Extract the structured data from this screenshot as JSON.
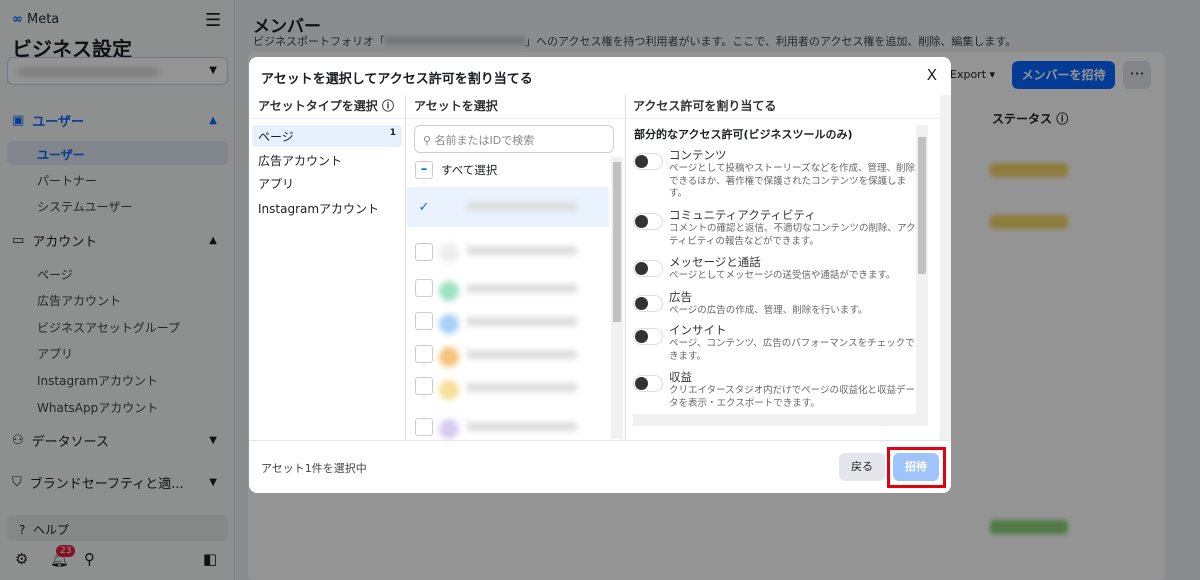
{
  "sidebar": {
    "brand": "Meta",
    "title": "ビジネス設定",
    "sections": [
      {
        "label": "ユーザー",
        "items": [
          "ユーザー",
          "パートナー",
          "システムユーザー"
        ]
      },
      {
        "label": "アカウント",
        "items": [
          "ページ",
          "広告アカウント",
          "ビジネスアセットグループ",
          "アプリ",
          "Instagramアカウント",
          "WhatsAppアカウント"
        ]
      },
      {
        "label": "データソース"
      },
      {
        "label": "ブランドセーフティと適..."
      }
    ],
    "help": "ヘルプ",
    "notification_count": "23"
  },
  "main": {
    "title": "メンバー",
    "desc_prefix": "ビジネスポートフォリオ「",
    "desc_suffix": "」へのアクセス権を持つ利用者がいます。ここで、利用者のアクセス権を追加、削除、編集します。",
    "export": "Export ▾",
    "invite": "メンバーを招待",
    "more": "···",
    "status_col": "ステータス"
  },
  "modal": {
    "title": "アセットを選択してアクセス許可を割り当てる",
    "close": "X",
    "col1": "アセットタイプを選択",
    "col2": "アセットを選択",
    "col3": "アクセス許可を割り当てる",
    "types": [
      {
        "label": "ページ",
        "count": "1"
      },
      {
        "label": "広告アカウント"
      },
      {
        "label": "アプリ"
      },
      {
        "label": "Instagramアカウント"
      }
    ],
    "search_placeholder": "名前またはIDで検索",
    "select_all": "すべて選択",
    "perm_header": "部分的なアクセス許可(ビジネスツールのみ)",
    "perms": [
      {
        "t": "コンテンツ",
        "d": "ページとして投稿やストーリーズなどを作成、管理、削除できるほか、著作権で保護されたコンテンツを保護します。"
      },
      {
        "t": "コミュニティアクティビティ",
        "d": "コメントの確認と返信、不適切なコンテンツの削除、アクティビティの報告などができます。"
      },
      {
        "t": "メッセージと通話",
        "d": "ページとしてメッセージの送受信や通話ができます。"
      },
      {
        "t": "広告",
        "d": "ページの広告の作成、管理、削除を行います。"
      },
      {
        "t": "インサイト",
        "d": "ページ、コンテンツ、広告のパフォーマンスをチェックできます。"
      },
      {
        "t": "収益",
        "d": "クリエイタースタジオ内だけでページの収益化と収益データを表示・エクスポートできます。"
      }
    ],
    "footer_text": "アセット1件を選択中",
    "back": "戻る",
    "invite": "招待"
  },
  "colors": {
    "accent": "#0866ff",
    "highlight": "#e3000f"
  }
}
